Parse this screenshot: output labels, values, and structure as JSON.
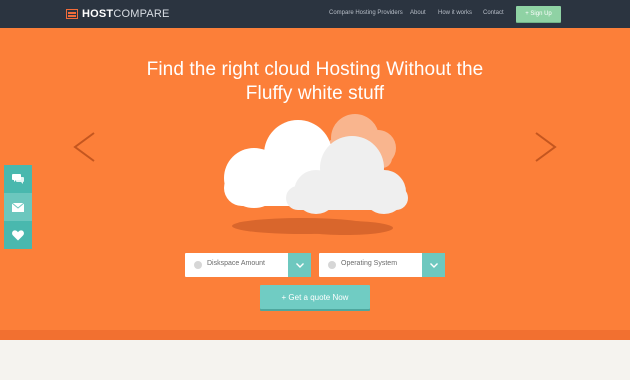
{
  "nav": {
    "logo_strong": "HOST",
    "logo_light": "COMPARE",
    "links": [
      "Compare Hosting Providers",
      "About",
      "How it works",
      "Contact"
    ],
    "signup_label": "+ Sign Up"
  },
  "hero": {
    "headline_line1": "Find the right cloud Hosting Without the",
    "headline_line2": "Fluffy white stuff",
    "select1_label": "Diskspace Amount",
    "select2_label": "Operating System",
    "cta_label": "+ Get a quote Now"
  },
  "side_bar": {
    "icons": [
      "chat-icon",
      "mail-icon",
      "heart-icon"
    ]
  },
  "colors": {
    "navbar": "#2b3440",
    "hero": "#fc7f39",
    "accent_teal": "#6ec8bf",
    "signup_green": "#8fd2a4",
    "footer_bg": "#f5f3ef"
  }
}
